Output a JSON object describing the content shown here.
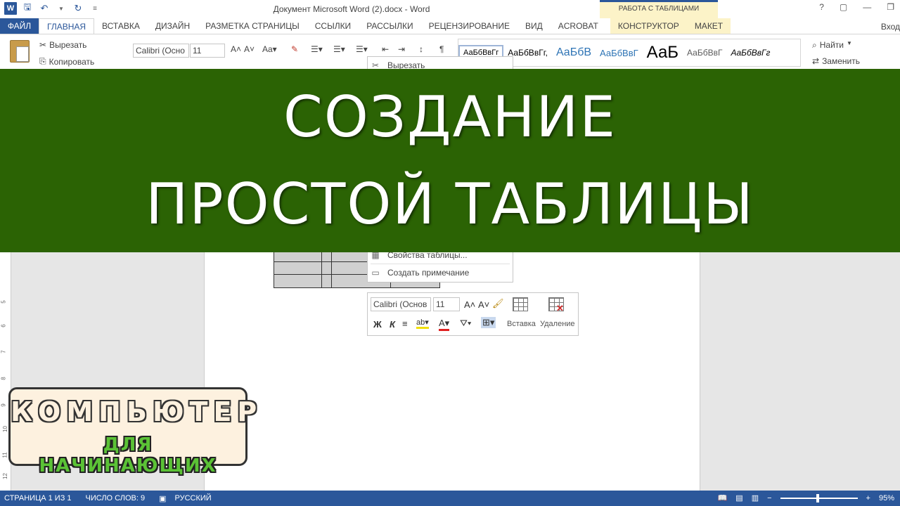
{
  "titlebar": {
    "doc_title": "Документ Microsoft Word (2).docx - Word",
    "context_group": "РАБОТА С ТАБЛИЦАМИ",
    "window_buttons": [
      "?",
      "▢",
      "—",
      "❐"
    ]
  },
  "tabs": {
    "file": "ФАЙЛ",
    "items": [
      "ГЛАВНАЯ",
      "ВСТАВКА",
      "ДИЗАЙН",
      "РАЗМЕТКА СТРАНИЦЫ",
      "ССЫЛКИ",
      "РАССЫЛКИ",
      "РЕЦЕНЗИРОВАНИЕ",
      "ВИД",
      "ACROBAT"
    ],
    "ctx_items": [
      "КОНСТРУКТОР",
      "МАКЕТ"
    ],
    "sign_in": "Вход"
  },
  "ribbon": {
    "cut": "Вырезать",
    "copy": "Копировать",
    "font": "Calibri (Осно",
    "size": "11",
    "styles": [
      "АаБбВвГг",
      "АаБбВвГг,",
      "АаБбВ",
      "АаБбВвГ",
      "АаБ",
      "АаБбВвГ",
      "АаБбВвГг"
    ],
    "find": "Найти",
    "replace": "Заменить"
  },
  "context_menu": {
    "top_item": "Вырезать",
    "table_props": "Свойства таблицы...",
    "add_comment": "Создать примечание"
  },
  "mini_toolbar": {
    "font": "Calibri (Основ",
    "size": "11",
    "bold": "Ж",
    "italic": "К",
    "insert": "Вставка",
    "delete": "Удаление"
  },
  "banner": {
    "line1": "СОЗДАНИЕ",
    "line2": "ПРОСТОЙ ТАБЛИЦЫ",
    "color": "#2b6304"
  },
  "logo": {
    "line1": "КОМПЬЮТЕР",
    "line2": "ДЛЯ НАЧИНАЮЩИХ"
  },
  "statusbar": {
    "page": "СТРАНИЦА 1 ИЗ 1",
    "words": "ЧИСЛО СЛОВ: 9",
    "lang": "РУССКИЙ",
    "zoom": "95%",
    "zoom_value": 95
  },
  "ruler_numbers": [
    "5",
    "6",
    "7",
    "8",
    "9",
    "10",
    "11",
    "12"
  ],
  "colors": {
    "accent": "#2b579a",
    "context_tab_bg": "#fcf3c8",
    "logo_green": "#5bc236"
  }
}
